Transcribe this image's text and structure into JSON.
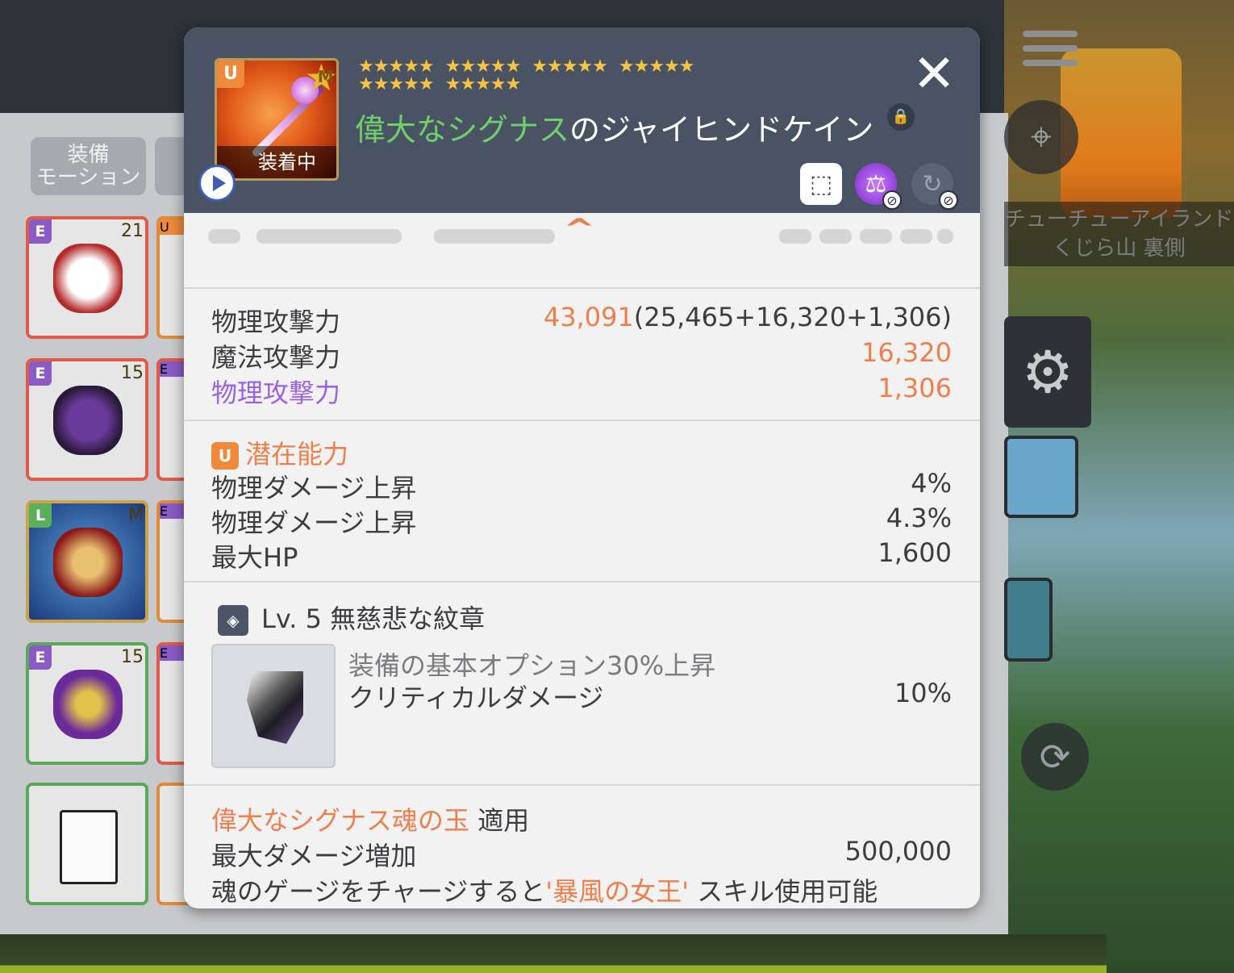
{
  "background": {
    "side_tab_label": "装備\nモーション",
    "map_name_line1": "チューチューアイランド",
    "map_name_line2": "くじら山 裏側",
    "inventory_slots": [
      {
        "grade": "E",
        "level": "21",
        "border": "#e05a4a"
      },
      {
        "grade": "E",
        "level": "15",
        "border": "#e05a4a"
      },
      {
        "grade": "L",
        "level": "M",
        "border": "#c9a24a"
      },
      {
        "grade": "E",
        "level": "15",
        "border": "#5aa85a"
      },
      {
        "grade": "",
        "level": "",
        "border": "#5aa85a"
      }
    ],
    "partial_slot_grades": [
      "U",
      "E",
      "E",
      "E"
    ]
  },
  "tooltip": {
    "item_grade_badge": "U",
    "star_badge": "M",
    "equipped_label": "装着中",
    "star_groups": [
      5,
      5,
      5,
      5,
      5,
      5
    ],
    "item_name_prefix": "偉大なシグナス",
    "item_name_suffix": "のジャイヒンドケイン",
    "close_label": "✕",
    "lock_icon": "lock-icon",
    "action_icons": [
      "share-box-icon",
      "scale-icon",
      "reset-icon"
    ],
    "stats": [
      {
        "label": "物理攻撃力",
        "value_main": "43,091",
        "value_detail": "(25,465+16,320+1,306)",
        "label_color": "default"
      },
      {
        "label": "魔法攻撃力",
        "value_main": "16,320",
        "value_detail": "",
        "label_color": "default"
      },
      {
        "label": "物理攻撃力",
        "value_main": "1,306",
        "value_detail": "",
        "label_color": "purple"
      }
    ],
    "potential": {
      "badge": "U",
      "title": "潜在能力",
      "lines": [
        {
          "label": "物理ダメージ上昇",
          "value": "4%"
        },
        {
          "label": "物理ダメージ上昇",
          "value": "4.3%"
        },
        {
          "label": "最大HP",
          "value": "1,600"
        }
      ]
    },
    "emblem": {
      "title": "Lv. 5 無慈悲な紋章",
      "desc": "装備の基本オプション30%上昇",
      "stat_label": "クリティカルダメージ",
      "stat_value": "10%"
    },
    "soul": {
      "name": "偉大なシグナス魂の玉",
      "applied": "適用",
      "stat_label": "最大ダメージ増加",
      "stat_value": "500,000",
      "skill_pre": "魂のゲージをチャージすると",
      "skill_name": "'暴風の女王'",
      "skill_post": " スキル使用可能"
    }
  }
}
